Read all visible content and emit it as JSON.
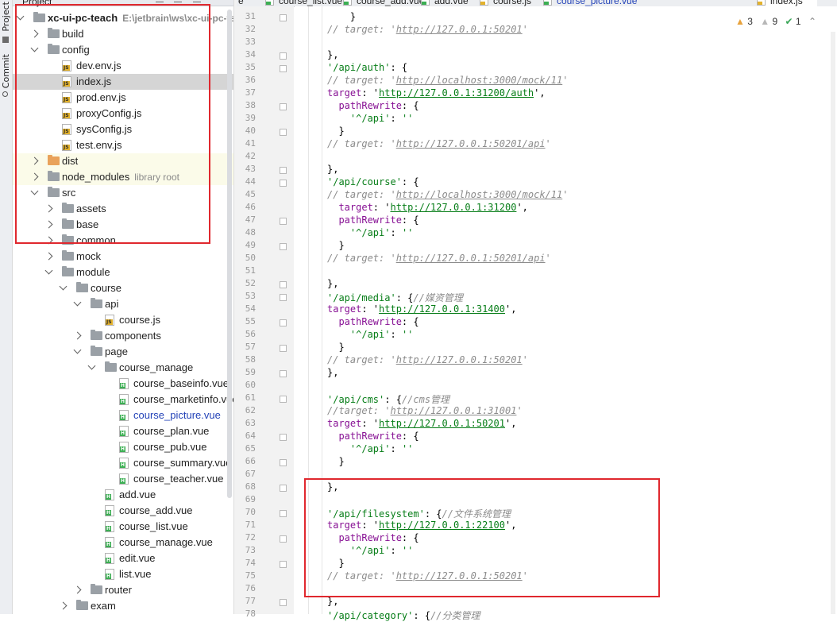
{
  "sidebar": {
    "project_label": "Project",
    "commit_label": "Commit"
  },
  "tree_header": {
    "title": "Project"
  },
  "tree": [
    {
      "depth": 0,
      "expanded": true,
      "icon": "folder-gray",
      "label": "xc-ui-pc-teach",
      "bold": true,
      "sub": "E:\\jetbrain\\ws\\xc-ui-pc-te"
    },
    {
      "depth": 1,
      "expanded": false,
      "icon": "folder-gray",
      "label": "build"
    },
    {
      "depth": 1,
      "expanded": true,
      "icon": "folder-gray",
      "label": "config"
    },
    {
      "depth": 2,
      "icon": "js",
      "label": "dev.env.js"
    },
    {
      "depth": 2,
      "icon": "js",
      "label": "index.js",
      "selected": true
    },
    {
      "depth": 2,
      "icon": "js",
      "label": "prod.env.js"
    },
    {
      "depth": 2,
      "icon": "js",
      "label": "proxyConfig.js"
    },
    {
      "depth": 2,
      "icon": "js",
      "label": "sysConfig.js"
    },
    {
      "depth": 2,
      "icon": "js",
      "label": "test.env.js"
    },
    {
      "depth": 1,
      "expanded": false,
      "icon": "folder-orange",
      "label": "dist",
      "tinted": true
    },
    {
      "depth": 1,
      "expanded": false,
      "icon": "folder-gray",
      "label": "node_modules",
      "sub": "library root",
      "tinted": true
    },
    {
      "depth": 1,
      "expanded": true,
      "icon": "folder-gray",
      "label": "src"
    },
    {
      "depth": 2,
      "expanded": false,
      "icon": "folder-gray",
      "label": "assets"
    },
    {
      "depth": 2,
      "expanded": false,
      "icon": "folder-gray",
      "label": "base"
    },
    {
      "depth": 2,
      "expanded": false,
      "icon": "folder-gray",
      "label": "common"
    },
    {
      "depth": 2,
      "expanded": false,
      "icon": "folder-gray",
      "label": "mock"
    },
    {
      "depth": 2,
      "expanded": true,
      "icon": "folder-gray",
      "label": "module"
    },
    {
      "depth": 3,
      "expanded": true,
      "icon": "folder-gray",
      "label": "course"
    },
    {
      "depth": 4,
      "expanded": true,
      "icon": "folder-gray",
      "label": "api"
    },
    {
      "depth": 5,
      "icon": "js",
      "label": "course.js"
    },
    {
      "depth": 4,
      "expanded": false,
      "icon": "folder-gray",
      "label": "components"
    },
    {
      "depth": 4,
      "expanded": true,
      "icon": "folder-gray",
      "label": "page"
    },
    {
      "depth": 5,
      "expanded": true,
      "icon": "folder-gray",
      "label": "course_manage"
    },
    {
      "depth": 6,
      "icon": "vue",
      "label": "course_baseinfo.vue"
    },
    {
      "depth": 6,
      "icon": "vue",
      "label": "course_marketinfo.vue"
    },
    {
      "depth": 6,
      "icon": "vue",
      "label": "course_picture.vue",
      "blue": true
    },
    {
      "depth": 6,
      "icon": "vue",
      "label": "course_plan.vue"
    },
    {
      "depth": 6,
      "icon": "vue",
      "label": "course_pub.vue"
    },
    {
      "depth": 6,
      "icon": "vue",
      "label": "course_summary.vue"
    },
    {
      "depth": 6,
      "icon": "vue",
      "label": "course_teacher.vue"
    },
    {
      "depth": 5,
      "icon": "vue",
      "label": "add.vue"
    },
    {
      "depth": 5,
      "icon": "vue",
      "label": "course_add.vue"
    },
    {
      "depth": 5,
      "icon": "vue",
      "label": "course_list.vue"
    },
    {
      "depth": 5,
      "icon": "vue",
      "label": "course_manage.vue"
    },
    {
      "depth": 5,
      "icon": "vue",
      "label": "edit.vue"
    },
    {
      "depth": 5,
      "icon": "vue",
      "label": "list.vue"
    },
    {
      "depth": 4,
      "expanded": false,
      "icon": "folder-gray",
      "label": "router"
    },
    {
      "depth": 3,
      "expanded": false,
      "icon": "folder-gray",
      "label": "exam"
    }
  ],
  "tabs": [
    {
      "label": "e",
      "type": "none"
    },
    {
      "label": "course_list.vue",
      "type": "vue"
    },
    {
      "label": "course_add.vue",
      "type": "vue"
    },
    {
      "label": "add.vue",
      "type": "vue"
    },
    {
      "label": "course.js",
      "type": "js"
    },
    {
      "label": "course_picture.vue",
      "type": "vue",
      "blue": true
    },
    {
      "label": "index.js",
      "type": "js",
      "active": true
    }
  ],
  "inspections": {
    "warnings": "3",
    "weak_warnings": "9",
    "ok": "1"
  },
  "code_lines": [
    {
      "n": "31",
      "t": [
        [
          "    }",
          ""
        ]
      ]
    },
    {
      "n": "32",
      "t": [
        [
          "// target: '",
          "c"
        ],
        [
          "http://127.0.0.1:50201",
          "cu"
        ],
        [
          "'",
          "c"
        ]
      ]
    },
    {
      "n": "33",
      "t": []
    },
    {
      "n": "34",
      "t": [
        [
          "},",
          ""
        ]
      ]
    },
    {
      "n": "35",
      "t": [
        [
          "'/api/auth'",
          "k"
        ],
        [
          ": {",
          ""
        ]
      ]
    },
    {
      "n": "36",
      "t": [
        [
          "// target: '",
          "c"
        ],
        [
          "http://localhost:3000/mock/11",
          "cu"
        ],
        [
          "'",
          "c"
        ]
      ]
    },
    {
      "n": "37",
      "t": [
        [
          "target",
          "p"
        ],
        [
          ": '",
          ""
        ],
        [
          "http://127.0.0.1:31200/auth",
          "u"
        ],
        [
          "',",
          ""
        ]
      ]
    },
    {
      "n": "38",
      "t": [
        [
          "  pathRewrite",
          "p"
        ],
        [
          ": {",
          ""
        ]
      ]
    },
    {
      "n": "39",
      "t": [
        [
          "    '^/api'",
          "k"
        ],
        [
          ": ",
          ""
        ],
        [
          "''",
          "k"
        ]
      ]
    },
    {
      "n": "40",
      "t": [
        [
          "  }",
          ""
        ]
      ]
    },
    {
      "n": "41",
      "t": [
        [
          "// target: '",
          "c"
        ],
        [
          "http://127.0.0.1:50201/api",
          "cu"
        ],
        [
          "'",
          "c"
        ]
      ]
    },
    {
      "n": "42",
      "t": []
    },
    {
      "n": "43",
      "t": [
        [
          "},",
          ""
        ]
      ]
    },
    {
      "n": "44",
      "t": [
        [
          "'/api/course'",
          "k"
        ],
        [
          ": {",
          ""
        ]
      ]
    },
    {
      "n": "45",
      "t": [
        [
          "// target: '",
          "c"
        ],
        [
          "http://localhost:3000/mock/11",
          "cu"
        ],
        [
          "'",
          "c"
        ]
      ]
    },
    {
      "n": "46",
      "t": [
        [
          "  target",
          "p"
        ],
        [
          ": '",
          ""
        ],
        [
          "http://127.0.0.1:31200",
          "u"
        ],
        [
          "',",
          ""
        ]
      ]
    },
    {
      "n": "47",
      "t": [
        [
          "  pathRewrite",
          "p"
        ],
        [
          ": {",
          ""
        ]
      ]
    },
    {
      "n": "48",
      "t": [
        [
          "    '^/api'",
          "k"
        ],
        [
          ": ",
          ""
        ],
        [
          "''",
          "k"
        ]
      ]
    },
    {
      "n": "49",
      "t": [
        [
          "  }",
          ""
        ]
      ]
    },
    {
      "n": "50",
      "t": [
        [
          "// target: '",
          "c"
        ],
        [
          "http://127.0.0.1:50201/api",
          "cu"
        ],
        [
          "'",
          "c"
        ]
      ]
    },
    {
      "n": "51",
      "t": []
    },
    {
      "n": "52",
      "t": [
        [
          "},",
          ""
        ]
      ]
    },
    {
      "n": "53",
      "t": [
        [
          "'/api/media'",
          "k"
        ],
        [
          ": {",
          ""
        ],
        [
          "//媒资管理",
          "c"
        ]
      ]
    },
    {
      "n": "54",
      "t": [
        [
          "target",
          "p"
        ],
        [
          ": '",
          ""
        ],
        [
          "http://127.0.0.1:31400",
          "u"
        ],
        [
          "',",
          ""
        ]
      ]
    },
    {
      "n": "55",
      "t": [
        [
          "  pathRewrite",
          "p"
        ],
        [
          ": {",
          ""
        ]
      ]
    },
    {
      "n": "56",
      "t": [
        [
          "    '^/api'",
          "k"
        ],
        [
          ": ",
          ""
        ],
        [
          "''",
          "k"
        ]
      ]
    },
    {
      "n": "57",
      "t": [
        [
          "  }",
          ""
        ]
      ]
    },
    {
      "n": "58",
      "t": [
        [
          "// target: '",
          "c"
        ],
        [
          "http://127.0.0.1:50201",
          "cu"
        ],
        [
          "'",
          "c"
        ]
      ]
    },
    {
      "n": "59",
      "t": [
        [
          "},",
          ""
        ]
      ]
    },
    {
      "n": "60",
      "t": []
    },
    {
      "n": "61",
      "t": [
        [
          "'/api/cms'",
          "k"
        ],
        [
          ": {",
          ""
        ],
        [
          "//cms管理",
          "c"
        ]
      ]
    },
    {
      "n": "62",
      "t": [
        [
          "//target: '",
          "c"
        ],
        [
          "http://127.0.0.1:31001",
          "cu"
        ],
        [
          "'",
          "c"
        ]
      ]
    },
    {
      "n": "63",
      "t": [
        [
          "target",
          "p"
        ],
        [
          ": '",
          ""
        ],
        [
          "http://127.0.0.1:50201",
          "u"
        ],
        [
          "',",
          ""
        ]
      ]
    },
    {
      "n": "64",
      "t": [
        [
          "  pathRewrite",
          "p"
        ],
        [
          ": {",
          ""
        ]
      ]
    },
    {
      "n": "65",
      "t": [
        [
          "    '^/api'",
          "k"
        ],
        [
          ": ",
          ""
        ],
        [
          "''",
          "k"
        ]
      ]
    },
    {
      "n": "66",
      "t": [
        [
          "  }",
          ""
        ]
      ]
    },
    {
      "n": "67",
      "t": []
    },
    {
      "n": "68",
      "t": [
        [
          "},",
          ""
        ]
      ]
    },
    {
      "n": "69",
      "t": []
    },
    {
      "n": "70",
      "t": [
        [
          "'/api/filesystem'",
          "k"
        ],
        [
          ": {",
          ""
        ],
        [
          "//文件系统管理",
          "c"
        ]
      ]
    },
    {
      "n": "71",
      "t": [
        [
          "target",
          "p"
        ],
        [
          ": '",
          ""
        ],
        [
          "http://127.0.0.1:22100",
          "u"
        ],
        [
          "',",
          ""
        ]
      ]
    },
    {
      "n": "72",
      "t": [
        [
          "  pathRewrite",
          "p"
        ],
        [
          ": {",
          ""
        ]
      ]
    },
    {
      "n": "73",
      "t": [
        [
          "    '^/api'",
          "k"
        ],
        [
          ": ",
          ""
        ],
        [
          "''",
          "k"
        ]
      ]
    },
    {
      "n": "74",
      "t": [
        [
          "  }",
          ""
        ]
      ]
    },
    {
      "n": "75",
      "t": [
        [
          "// target: '",
          "c"
        ],
        [
          "http://127.0.0.1:50201",
          "cu"
        ],
        [
          "'",
          "c"
        ]
      ]
    },
    {
      "n": "76",
      "t": []
    },
    {
      "n": "77",
      "t": [
        [
          "},",
          ""
        ]
      ]
    },
    {
      "n": "78",
      "t": [
        [
          "'/api/category'",
          "k"
        ],
        [
          ": {",
          ""
        ],
        [
          "//分类管理",
          "c"
        ]
      ]
    }
  ],
  "colors": {
    "highlight": "#e0282e",
    "selection": "#d5d5d5",
    "link": "#067d17",
    "property": "#871094"
  }
}
